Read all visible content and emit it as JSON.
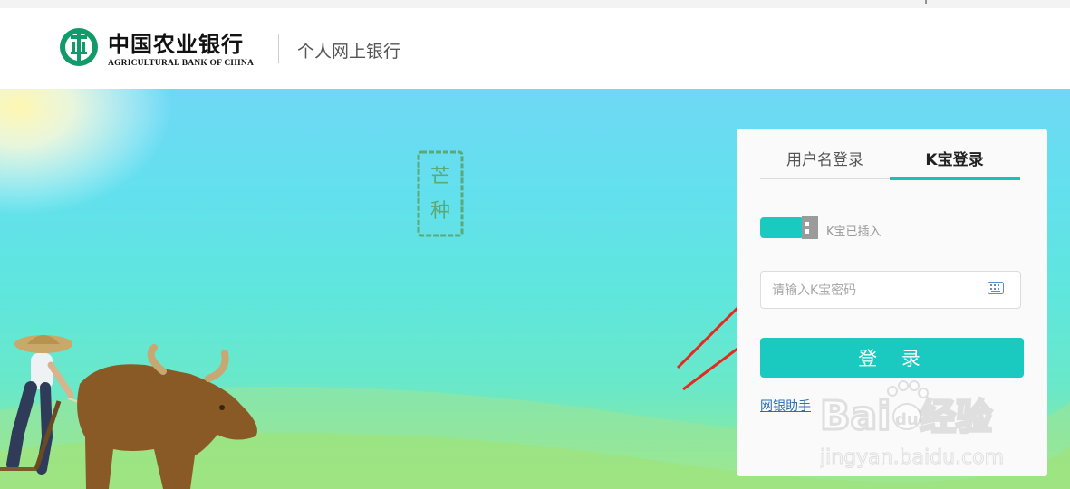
{
  "header": {
    "logo_cn": "中国农业银行",
    "logo_en": "AGRICULTURAL BANK OF CHINA",
    "subtitle": "个人网上银行"
  },
  "hero": {
    "stamp_chars": [
      "芒",
      "种"
    ]
  },
  "login": {
    "tabs": [
      {
        "label": "用户名登录",
        "active": false
      },
      {
        "label": "K宝登录",
        "active": true
      }
    ],
    "usb_status": "K宝已插入",
    "password_placeholder": "请输入K宝密码",
    "password_value": "",
    "login_button": "登 录",
    "helper_link": "网银助手"
  },
  "watermark": {
    "brand": "Bai",
    "brand2": "du",
    "cn": "经验",
    "url": "jingyan.baidu.com"
  },
  "colors": {
    "accent": "#1ac9c0",
    "arrow": "#e8281e",
    "link": "#2b6fb3",
    "logo_green": "#129a6a"
  }
}
